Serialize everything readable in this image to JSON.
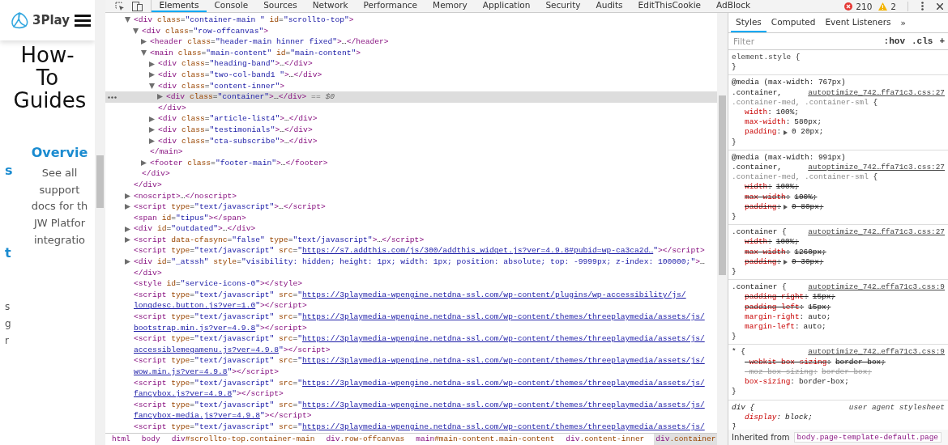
{
  "page": {
    "logo": "3Play",
    "title": "How-To Guides",
    "fragments": [
      {
        "text": "s",
        "kind": "link"
      },
      {
        "text": "t",
        "kind": "link"
      },
      {
        "text": "s",
        "kind": "text"
      },
      {
        "text": "g",
        "kind": "text"
      },
      {
        "text": "r",
        "kind": "text"
      }
    ],
    "card": {
      "heading": "Overvie",
      "lines": [
        "See all",
        "support",
        "docs for th",
        "JW Platfor",
        "integratio"
      ]
    }
  },
  "devtools": {
    "tabs": [
      {
        "label": "Elements",
        "selected": true
      },
      {
        "label": "Console",
        "selected": false
      },
      {
        "label": "Sources",
        "selected": false
      },
      {
        "label": "Network",
        "selected": false
      },
      {
        "label": "Performance",
        "selected": false
      },
      {
        "label": "Memory",
        "selected": false
      },
      {
        "label": "Application",
        "selected": false
      },
      {
        "label": "Security",
        "selected": false
      },
      {
        "label": "Audits",
        "selected": false
      },
      {
        "label": "EditThisCookie",
        "selected": false
      },
      {
        "label": "AdBlock",
        "selected": false
      }
    ],
    "errors": "210",
    "warnings": "2",
    "elements": {
      "nodes": [
        {
          "open": "<div class=\"container-main \" id=\"scrollto-top\">",
          "expanded": true,
          "selected": false,
          "close": "</div>",
          "children": [
            {
              "open": "<div class=\"row-offcanvas\">",
              "expanded": true,
              "selected": false,
              "close": "</div>",
              "children": [
                {
                  "open": "<header class=\"header-main hinner fixed\">…</header>",
                  "expanded": false,
                  "selected": false
                },
                {
                  "open": "<main class=\"main-content\" id=\"main-content\">",
                  "expanded": true,
                  "selected": false,
                  "close": "</main>",
                  "children": [
                    {
                      "open": "<div class=\"heading-band\">…</div>",
                      "expanded": false,
                      "selected": false
                    },
                    {
                      "open": "<div class=\"two-col-band1 \">…</div>",
                      "expanded": false,
                      "selected": false
                    },
                    {
                      "open": "<div class=\"content-inner\">",
                      "expanded": true,
                      "selected": false,
                      "close": "</div>",
                      "children": [
                        {
                          "open": "<div class=\"container\">…</div>",
                          "expanded": false,
                          "selected": true,
                          "marker": "== $0"
                        }
                      ]
                    },
                    {
                      "open": "<div class=\"article-list4\">…</div>",
                      "expanded": false,
                      "selected": false
                    },
                    {
                      "open": "<div class=\"testimonials\">…</div>",
                      "expanded": false,
                      "selected": false
                    },
                    {
                      "open": "<div class=\"cta-subscribe\">…</div>",
                      "expanded": false,
                      "selected": false
                    }
                  ]
                },
                {
                  "open": "<footer class=\"footer-main\">…</footer>",
                  "expanded": false,
                  "selected": false
                }
              ]
            }
          ]
        },
        {
          "open": "<noscript>…</noscript>",
          "expanded": false,
          "selected": false
        },
        {
          "open": "<script type=\"text/javascript\">…</script>",
          "expanded": false,
          "selected": false
        },
        {
          "open": "<span id=\"tipus\"></span>",
          "selected": false
        },
        {
          "open": "<div id=\"outdated\">…</div>",
          "expanded": false,
          "selected": false
        },
        {
          "open": "<script data-cfasync=\"false\" type=\"text/javascript\">…</script>",
          "expanded": false,
          "selected": false
        },
        {
          "open": "<script type=\"text/javascript\" src=\"",
          "after": "\"></script>",
          "link": [
            "https://s7.addthis.com/js/300/addthis_widget.js?ver=4.9.8#pubid=wp-ca3ca2d…"
          ],
          "selected": false
        },
        {
          "open": "<div id=\"_atssh\" style=\"visibility: hidden; height: 1px; width: 1px; position: absolute; top: -9999px; z-index: 100000;\">…</div>",
          "expanded": false,
          "selected": false
        },
        {
          "open": "<style id=\"service-icons-0\"></style>",
          "selected": false
        },
        {
          "open": "<script type=\"text/javascript\" src=\"",
          "after": "\"></script>",
          "link": [
            "https://3playmedia-wpengine.netdna-ssl.com/wp-content/plugins/wp-accessibility/js/",
            "longdesc.button.js?ver=1.0"
          ],
          "selected": false
        },
        {
          "open": "<script type=\"text/javascript\" src=\"",
          "after": "\"></script>",
          "link": [
            "https://3playmedia-wpengine.netdna-ssl.com/wp-content/themes/threeplaymedia/assets/js/",
            "bootstrap.min.js?ver=4.9.8"
          ],
          "selected": false
        },
        {
          "open": "<script type=\"text/javascript\" src=\"",
          "after": "\"></script>",
          "link": [
            "https://3playmedia-wpengine.netdna-ssl.com/wp-content/themes/threeplaymedia/assets/js/",
            "accessiblemegamenu.js?ver=4.9.8"
          ],
          "selected": false
        },
        {
          "open": "<script type=\"text/javascript\" src=\"",
          "after": "\"></script>",
          "link": [
            "https://3playmedia-wpengine.netdna-ssl.com/wp-content/themes/threeplaymedia/assets/js/",
            "wow.min.js?ver=4.9.8"
          ],
          "selected": false
        },
        {
          "open": "<script type=\"text/javascript\" src=\"",
          "after": "\"></script>",
          "link": [
            "https://3playmedia-wpengine.netdna-ssl.com/wp-content/themes/threeplaymedia/assets/js/",
            "fancybox.js?ver=4.9.8"
          ],
          "selected": false
        },
        {
          "open": "<script type=\"text/javascript\" src=\"",
          "after": "\"></script>",
          "link": [
            "https://3playmedia-wpengine.netdna-ssl.com/wp-content/themes/threeplaymedia/assets/js/",
            "fancybox-media.js?ver=4.9.8"
          ],
          "selected": false
        },
        {
          "open": "<script type=\"text/javascript\" src=\"",
          "link": [
            "https://3playmedia-wpengine.netdna-ssl.com/wp-content/themes/threeplaymedia/assets/js/"
          ],
          "selected": false
        }
      ],
      "breadcrumb": [
        {
          "text": "html",
          "selected": false
        },
        {
          "text": "body",
          "selected": false
        },
        {
          "text": "div#scrollto-top.container-main",
          "selected": false
        },
        {
          "text": "div.row-offcanvas",
          "selected": false
        },
        {
          "text": "main#main-content.main-content",
          "selected": false
        },
        {
          "text": "div.content-inner",
          "selected": false
        },
        {
          "text": "div.container",
          "selected": true
        }
      ]
    },
    "styles": {
      "tabs": [
        {
          "label": "Styles",
          "selected": true
        },
        {
          "label": "Computed",
          "selected": false
        },
        {
          "label": "Event Listeners",
          "selected": false
        }
      ],
      "more": "»",
      "filter": {
        "placeholder": "Filter"
      },
      "buttons": [
        ":hov",
        ".cls",
        "+"
      ],
      "rules": [
        {
          "kind": "inline",
          "selector": [
            {
              "text": "element.style",
              "matched": true
            }
          ],
          "open": "{",
          "close": "}"
        },
        {
          "kind": "author",
          "media": "@media (max-width: 767px)",
          "selector": [
            {
              "text": ".container,",
              "matched": true
            },
            {
              "text": ".container-med, .container-sml",
              "matched": false
            }
          ],
          "source": "autoptimize_742…ffa71c3.css:27",
          "open": "{",
          "close": "}",
          "props": [
            {
              "name": "width",
              "sep": ":",
              "value": "100%;",
              "overridden": false,
              "invalid": false
            },
            {
              "name": "max-width",
              "sep": ":",
              "value": "580px;",
              "overridden": false,
              "invalid": false
            },
            {
              "name": "padding",
              "sep": ":",
              "value": "0 20px;",
              "overridden": false,
              "invalid": false,
              "expandable": true
            }
          ]
        },
        {
          "kind": "author",
          "media": "@media (max-width: 991px)",
          "selector": [
            {
              "text": ".container,",
              "matched": true
            },
            {
              "text": ".container-med, .container-sml",
              "matched": false
            }
          ],
          "source": "autoptimize_742…ffa71c3.css:27",
          "open": "{",
          "close": "}",
          "props": [
            {
              "name": "width",
              "sep": ":",
              "value": "100%;",
              "overridden": true,
              "invalid": false
            },
            {
              "name": "max-width",
              "sep": ":",
              "value": "100%;",
              "overridden": true,
              "invalid": false
            },
            {
              "name": "padding",
              "sep": ":",
              "value": "0 80px;",
              "overridden": true,
              "invalid": false,
              "expandable": true
            }
          ]
        },
        {
          "kind": "author",
          "selector": [
            {
              "text": ".container",
              "matched": true
            }
          ],
          "source": "autoptimize_742…ffa71c3.css:27",
          "open": "{",
          "close": "}",
          "props": [
            {
              "name": "width",
              "sep": ":",
              "value": "100%;",
              "overridden": true,
              "invalid": false
            },
            {
              "name": "max-width",
              "sep": ":",
              "value": "1260px;",
              "overridden": true,
              "invalid": false
            },
            {
              "name": "padding",
              "sep": ":",
              "value": "0 30px;",
              "overridden": true,
              "invalid": false,
              "expandable": true
            }
          ]
        },
        {
          "kind": "author",
          "selector": [
            {
              "text": ".container",
              "matched": true
            }
          ],
          "source": "autoptimize_742…effa71c3.css:9",
          "open": "{",
          "close": "}",
          "props": [
            {
              "name": "padding-right",
              "sep": ":",
              "value": "15px;",
              "overridden": true,
              "invalid": false
            },
            {
              "name": "padding-left",
              "sep": ":",
              "value": "15px;",
              "overridden": true,
              "invalid": false
            },
            {
              "name": "margin-right",
              "sep": ":",
              "value": "auto;",
              "overridden": false,
              "invalid": false
            },
            {
              "name": "margin-left",
              "sep": ":",
              "value": "auto;",
              "overridden": false,
              "invalid": false
            }
          ]
        },
        {
          "kind": "author",
          "selector": [
            {
              "text": "*",
              "matched": true
            }
          ],
          "source": "autoptimize_742…effa71c3.css:9",
          "open": "{",
          "close": "}",
          "props": [
            {
              "name": "-webkit-box-sizing",
              "sep": ":",
              "value": "border-box;",
              "overridden": true,
              "invalid": false
            },
            {
              "name": "-moz-box-sizing",
              "sep": ":",
              "value": "border-box;",
              "overridden": true,
              "invalid": true
            },
            {
              "name": "box-sizing",
              "sep": ":",
              "value": "border-box;",
              "overridden": false,
              "invalid": false
            }
          ]
        },
        {
          "kind": "user_agent",
          "selector": [
            {
              "text": "div",
              "matched": true
            }
          ],
          "source": "user agent stylesheet",
          "open": "{",
          "close": "}",
          "props": [
            {
              "name": "display",
              "sep": ":",
              "value": "block;",
              "overridden": false,
              "invalid": false
            }
          ]
        }
      ],
      "inherited": {
        "label": "Inherited from",
        "selector": "body.page-template-default.page"
      }
    }
  }
}
